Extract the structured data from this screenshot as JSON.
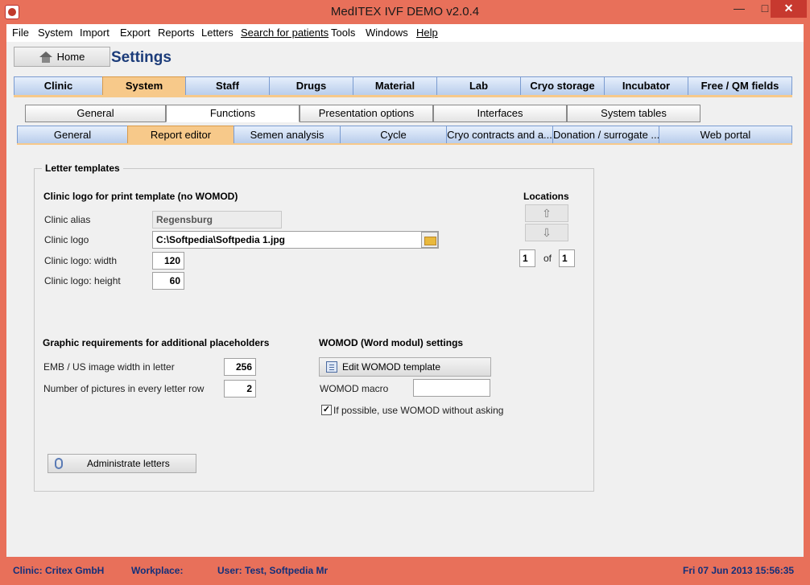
{
  "window": {
    "title": "MedITEX IVF DEMO v2.0.4",
    "min": "—",
    "max": "□",
    "close": "✕"
  },
  "menu": [
    "File",
    "System",
    "Import",
    "Export",
    "Reports",
    "Letters",
    "Search for patients",
    "Tools",
    "Windows",
    "Help"
  ],
  "header": {
    "home_label": "Home",
    "page_title": "Settings"
  },
  "main_tabs": [
    "Clinic",
    "System",
    "Staff",
    "Drugs",
    "Material",
    "Lab",
    "Cryo storage",
    "Incubator",
    "Free / QM fields"
  ],
  "sub_tabs": [
    "General",
    "Functions",
    "Presentation options",
    "Interfaces",
    "System tables"
  ],
  "sub_sub_tabs": [
    "General",
    "Report editor",
    "Semen analysis",
    "Cycle",
    "Cryo contracts and a...",
    "Donation / surrogate ...",
    "Web portal"
  ],
  "letter_templates": {
    "group_title": "Letter templates",
    "logo_section_title": "Clinic logo for print template (no WOMOD)",
    "alias_label": "Clinic alias",
    "alias_value": "Regensburg",
    "logo_label": "Clinic logo",
    "logo_value": "C:\\Softpedia\\Softpedia 1.jpg",
    "width_label": "Clinic logo: width",
    "width_value": "120",
    "height_label": "Clinic logo: height",
    "height_value": "60",
    "locations_title": "Locations",
    "loc_up": "⇧",
    "loc_down": "⇩",
    "loc_current": "1",
    "loc_of": "of",
    "loc_total": "1",
    "graphic_title": "Graphic requirements for additional placeholders",
    "emb_label": "EMB / US image width in letter",
    "emb_value": "256",
    "pics_label": "Number of pictures in every letter row",
    "pics_value": "2",
    "womod_title": "WOMOD (Word modul) settings",
    "edit_womod_label": "Edit WOMOD template",
    "womod_macro_label": "WOMOD macro",
    "womod_macro_value": "",
    "womod_checkbox_label": "If possible, use WOMOD without asking",
    "womod_checkbox_mark": "✓",
    "admin_letters_label": "Administrate letters"
  },
  "status": {
    "clinic": "Clinic: Critex GmbH",
    "workplace": "Workplace:",
    "user": "User: Test, Softpedia Mr",
    "datetime": "Fri 07 Jun 2013 15:56:35"
  }
}
